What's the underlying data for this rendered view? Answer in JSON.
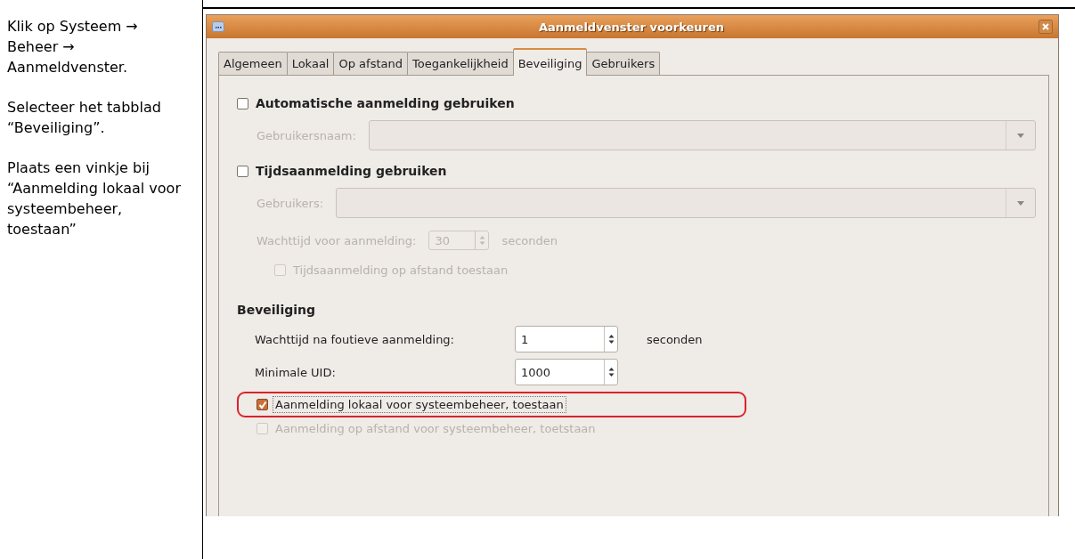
{
  "instructions": [
    "Klik op Systeem → Beheer → Aanmeldvenster.",
    "Selecteer het tabblad “Beveiliging”.",
    "Plaats een vinkje bij “Aanmelding lokaal voor systeembeheer, toestaan”"
  ],
  "window": {
    "title": "Aanmeldvenster voorkeuren"
  },
  "tabs": [
    {
      "label": "Algemeen",
      "selected": false
    },
    {
      "label": "Lokaal",
      "selected": false
    },
    {
      "label": "Op afstand",
      "selected": false
    },
    {
      "label": "Toegankelijkheid",
      "selected": false
    },
    {
      "label": "Beveiliging",
      "selected": true
    },
    {
      "label": "Gebruikers",
      "selected": false
    }
  ],
  "rows": [
    {
      "kind": "check",
      "label": "Automatische aanmelding gebruiken",
      "checked": false,
      "disabled": false,
      "highlighted": false,
      "children": [
        {
          "kind": "combo",
          "label": "Gebruikersnaam:",
          "disabled": true
        }
      ]
    },
    {
      "kind": "check",
      "label": "Tijdsaanmelding gebruiken",
      "checked": false,
      "disabled": false,
      "highlighted": false,
      "children": [
        {
          "kind": "combo",
          "label": "Gebruikers:",
          "disabled": true
        },
        {
          "kind": "spin",
          "label": "Wachttijd voor aanmelding:",
          "value": "30",
          "unit": "seconden",
          "disabled": true
        },
        {
          "kind": "check",
          "label": "Tijdsaanmelding op afstand toestaan",
          "checked": false,
          "disabled": true,
          "highlighted": false
        }
      ]
    },
    {
      "kind": "heading",
      "label": "Beveiliging",
      "children": [
        {
          "kind": "spin",
          "label": "Wachttijd na foutieve aanmelding:",
          "value": "1",
          "unit": "seconden",
          "disabled": false
        },
        {
          "kind": "spin",
          "label": "Minimale UID:",
          "value": "1000",
          "disabled": false
        },
        {
          "kind": "check",
          "label": "Aanmelding lokaal voor systeembeheer, toestaan",
          "checked": true,
          "disabled": false,
          "highlighted": true
        },
        {
          "kind": "check",
          "label": "Aanmelding op afstand voor systeembeheer, toetstaan",
          "checked": false,
          "disabled": true,
          "highlighted": false
        }
      ]
    }
  ]
}
